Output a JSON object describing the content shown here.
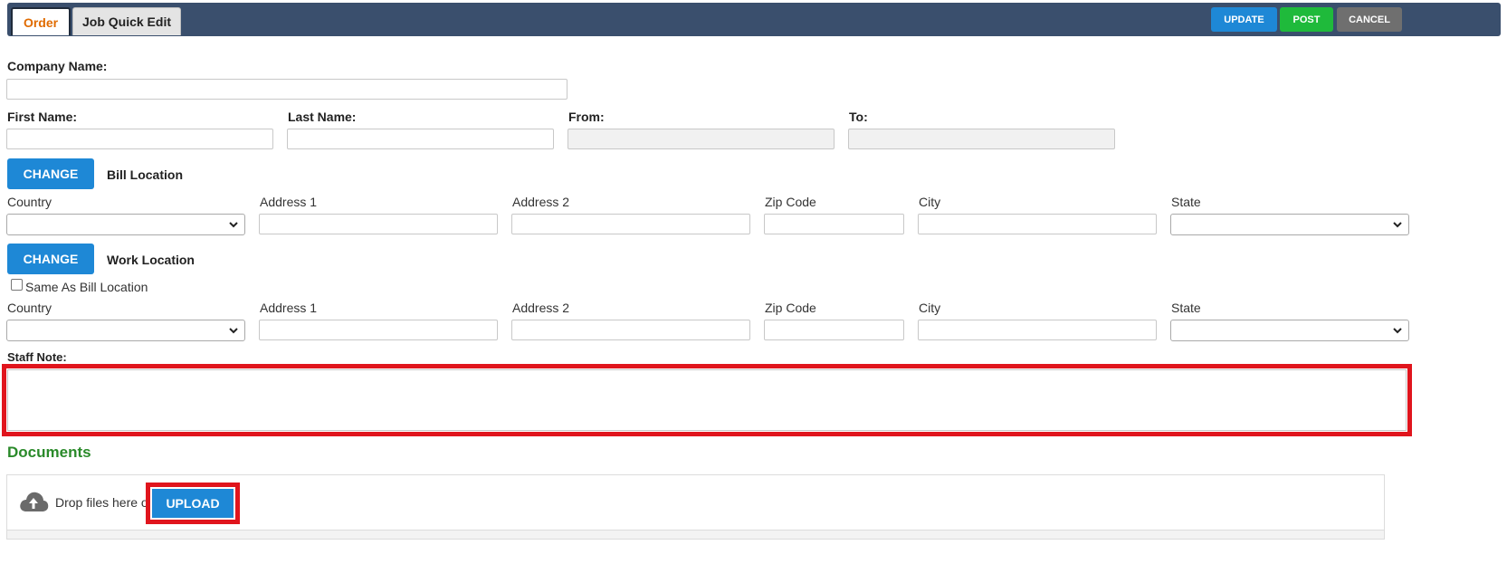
{
  "tabs": {
    "order": "Order",
    "job_quick_edit": "Job Quick Edit"
  },
  "toolbar": {
    "update": "UPDATE",
    "post": "POST",
    "cancel": "CANCEL"
  },
  "form": {
    "company_name_label": "Company Name:",
    "company_name_value": "",
    "first_name_label": "First Name:",
    "first_name_value": "",
    "last_name_label": "Last Name:",
    "last_name_value": "",
    "from_label": "From:",
    "from_value": "",
    "to_label": "To:",
    "to_value": ""
  },
  "bill_location": {
    "change_label": "CHANGE",
    "title": "Bill Location",
    "country_label": "Country",
    "address1_label": "Address 1",
    "address2_label": "Address 2",
    "zip_label": "Zip Code",
    "city_label": "City",
    "state_label": "State"
  },
  "work_location": {
    "change_label": "CHANGE",
    "title": "Work Location",
    "same_as_label": "Same As Bill Location",
    "same_as_checked": false,
    "country_label": "Country",
    "address1_label": "Address 1",
    "address2_label": "Address 2",
    "zip_label": "Zip Code",
    "city_label": "City",
    "state_label": "State"
  },
  "staff_note": {
    "label": "Staff Note:",
    "value": ""
  },
  "documents": {
    "title": "Documents",
    "drop_text": "Drop files here or",
    "upload_label": "UPLOAD"
  },
  "colors": {
    "topbar": "#3a4f6d",
    "primary": "#1e88d6",
    "post": "#1fba3b",
    "cancel": "#6f6f6f",
    "highlight": "#e0151d",
    "documents_title": "#2a8a2a",
    "order_tab_text": "#e06b00"
  }
}
